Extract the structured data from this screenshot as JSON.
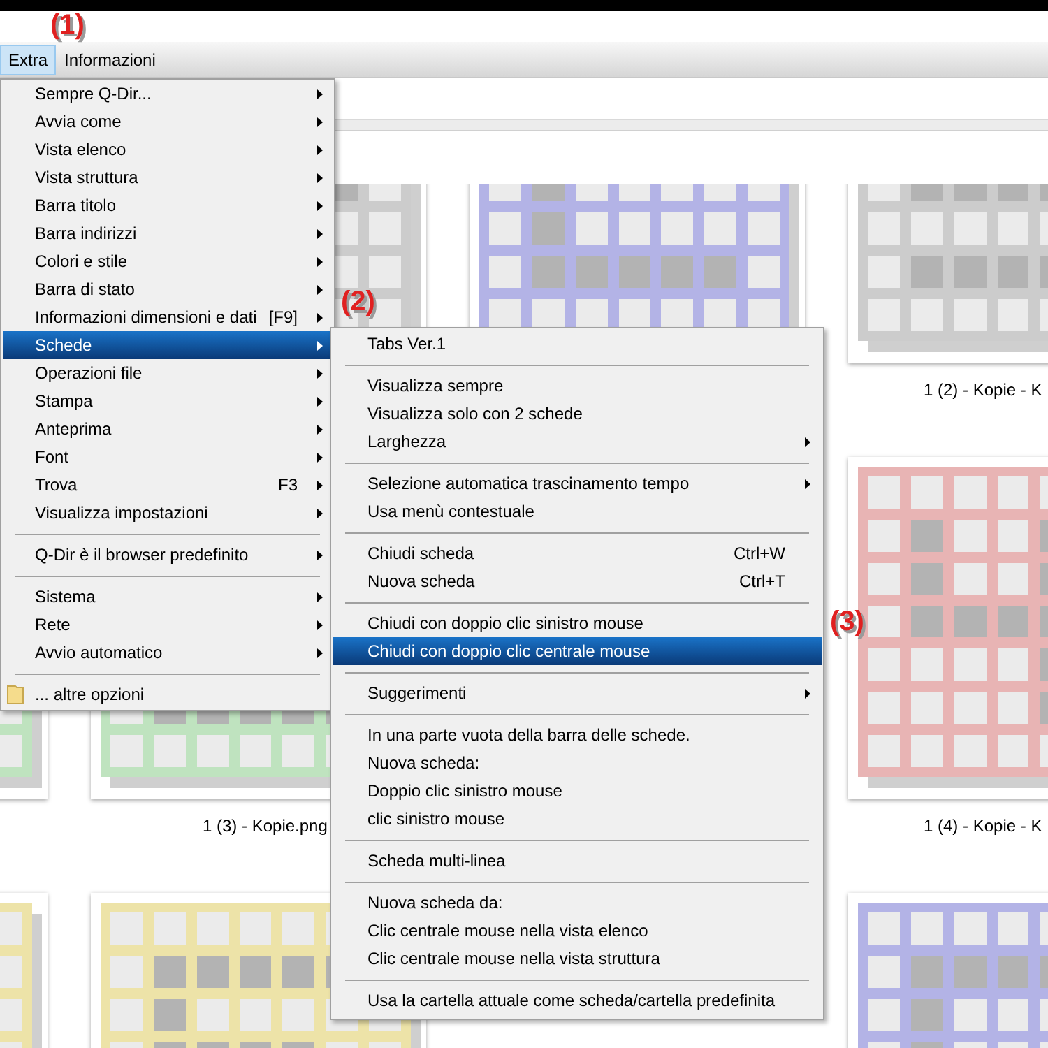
{
  "menu_bar": [
    {
      "label": "Extra",
      "selected": true
    },
    {
      "label": "Informazioni",
      "selected": false
    }
  ],
  "annotations": [
    "(1)",
    "(2)",
    "(3)"
  ],
  "extra_menu": [
    {
      "kind": "item",
      "label": "Sempre Q-Dir...",
      "submenu": true,
      "selected": false
    },
    {
      "kind": "item",
      "label": "Avvia come",
      "submenu": true,
      "selected": false
    },
    {
      "kind": "item",
      "label": "Vista elenco",
      "submenu": true,
      "selected": false
    },
    {
      "kind": "item",
      "label": "Vista struttura",
      "submenu": true,
      "selected": false
    },
    {
      "kind": "item",
      "label": "Barra titolo",
      "submenu": true,
      "selected": false
    },
    {
      "kind": "item",
      "label": "Barra indirizzi",
      "submenu": true,
      "selected": false
    },
    {
      "kind": "item",
      "label": "Colori e stile",
      "submenu": true,
      "selected": false
    },
    {
      "kind": "item",
      "label": "Barra di stato",
      "submenu": true,
      "selected": false
    },
    {
      "kind": "item",
      "label": "Informazioni dimensioni e dati",
      "shortcut": "[F9]",
      "submenu": true,
      "selected": false
    },
    {
      "kind": "item",
      "label": "Schede",
      "submenu": true,
      "selected": true
    },
    {
      "kind": "item",
      "label": "Operazioni file",
      "submenu": true,
      "selected": false
    },
    {
      "kind": "item",
      "label": "Stampa",
      "submenu": true,
      "selected": false
    },
    {
      "kind": "item",
      "label": "Anteprima",
      "submenu": true,
      "selected": false
    },
    {
      "kind": "item",
      "label": "Font",
      "submenu": true,
      "selected": false
    },
    {
      "kind": "item",
      "label": "Trova",
      "shortcut": "F3",
      "submenu": true,
      "selected": false
    },
    {
      "kind": "item",
      "label": "Visualizza impostazioni",
      "submenu": true,
      "selected": false
    },
    {
      "kind": "separator"
    },
    {
      "kind": "item",
      "label": "Q-Dir è il browser predefinito",
      "submenu": true,
      "selected": false
    },
    {
      "kind": "separator"
    },
    {
      "kind": "item",
      "label": "Sistema",
      "submenu": true,
      "selected": false
    },
    {
      "kind": "item",
      "label": "Rete",
      "submenu": true,
      "selected": false
    },
    {
      "kind": "item",
      "label": "Avvio automatico",
      "submenu": true,
      "selected": false
    },
    {
      "kind": "separator"
    },
    {
      "kind": "folder_item",
      "label": "... altre opzioni",
      "submenu": false,
      "selected": false
    }
  ],
  "schede_submenu": [
    {
      "kind": "item",
      "label": "Tabs Ver.1",
      "submenu": false,
      "selected": false
    },
    {
      "kind": "separator"
    },
    {
      "kind": "item",
      "label": "Visualizza sempre",
      "submenu": false,
      "selected": false
    },
    {
      "kind": "item",
      "label": "Visualizza solo con 2 schede",
      "submenu": false,
      "selected": false
    },
    {
      "kind": "item",
      "label": "Larghezza",
      "submenu": true,
      "selected": false
    },
    {
      "kind": "separator"
    },
    {
      "kind": "item",
      "label": "Selezione automatica trascinamento tempo",
      "submenu": true,
      "selected": false
    },
    {
      "kind": "item",
      "label": "Usa menù contestuale",
      "submenu": false,
      "selected": false
    },
    {
      "kind": "separator"
    },
    {
      "kind": "item",
      "label": "Chiudi scheda",
      "shortcut": "Ctrl+W",
      "submenu": false,
      "selected": false
    },
    {
      "kind": "item",
      "label": "Nuova scheda",
      "shortcut": "Ctrl+T",
      "submenu": false,
      "selected": false
    },
    {
      "kind": "separator"
    },
    {
      "kind": "item",
      "label": "Chiudi con doppio clic sinistro mouse",
      "submenu": false,
      "selected": false
    },
    {
      "kind": "item",
      "label": "Chiudi con doppio clic centrale mouse",
      "submenu": false,
      "selected": true
    },
    {
      "kind": "separator"
    },
    {
      "kind": "item",
      "label": "Suggerimenti",
      "submenu": true,
      "selected": false
    },
    {
      "kind": "separator"
    },
    {
      "kind": "item",
      "label": "In una parte vuota della barra delle schede.",
      "submenu": false,
      "selected": false
    },
    {
      "kind": "item",
      "label": "Nuova scheda:",
      "submenu": false,
      "selected": false
    },
    {
      "kind": "item",
      "label": "Doppio clic sinistro mouse",
      "submenu": false,
      "selected": false
    },
    {
      "kind": "item",
      "label": "clic sinistro mouse",
      "submenu": false,
      "selected": false
    },
    {
      "kind": "separator"
    },
    {
      "kind": "item",
      "label": "Scheda multi-linea",
      "submenu": false,
      "selected": false
    },
    {
      "kind": "separator"
    },
    {
      "kind": "item",
      "label": "Nuova scheda da:",
      "submenu": false,
      "selected": false
    },
    {
      "kind": "item",
      "label": "Clic centrale mouse nella vista elenco",
      "submenu": false,
      "selected": false
    },
    {
      "kind": "item",
      "label": "Clic centrale mouse nella vista struttura",
      "submenu": false,
      "selected": false
    },
    {
      "kind": "separator"
    },
    {
      "kind": "item",
      "label": "Usa la cartella attuale come scheda/cartella predefinita",
      "submenu": false,
      "selected": false
    }
  ],
  "thumbnails": [
    {
      "kind": "blank"
    },
    {
      "kind": "image",
      "color": "#cccccc"
    },
    {
      "kind": "image",
      "color": "#b3b3e6"
    },
    {
      "kind": "image",
      "color": "#cccccc",
      "label": "1 (2) - Kopie - K"
    },
    {
      "kind": "image",
      "color": "#bfe3bf"
    },
    {
      "kind": "image",
      "color": "#bfe3bf",
      "label": "1 (3) - Kopie.png"
    },
    {
      "kind": "blank"
    },
    {
      "kind": "image",
      "color": "#e8b4b4",
      "label": "1 (4) - Kopie - K"
    },
    {
      "kind": "image",
      "color": "#ede3a8"
    },
    {
      "kind": "image",
      "color": "#ede3a8"
    },
    {
      "kind": "blank"
    },
    {
      "kind": "image",
      "color": "#b3b3e6"
    }
  ]
}
